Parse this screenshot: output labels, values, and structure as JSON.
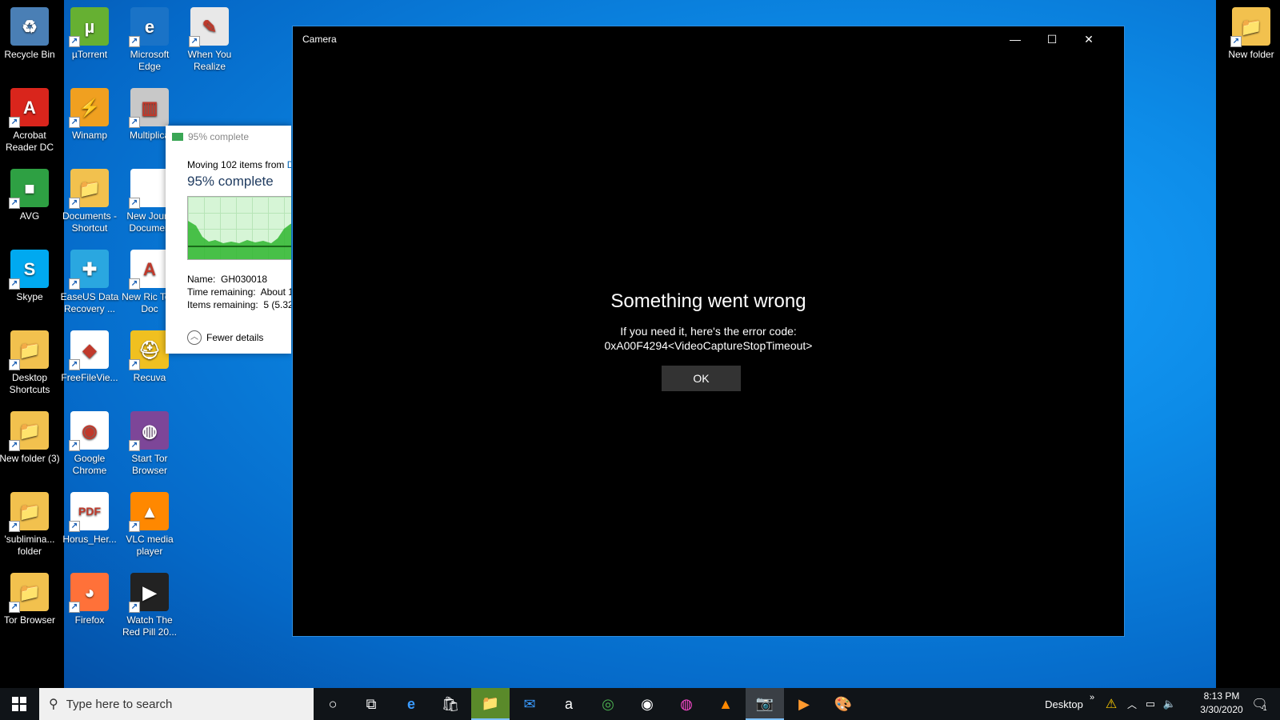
{
  "desktop": {
    "icons": [
      {
        "label": "Recycle Bin",
        "icon": "recycle-bin-icon",
        "color": "#4a7fb5",
        "glyph": "♻"
      },
      {
        "label": "µTorrent",
        "icon": "utorrent-icon",
        "color": "#66b032",
        "glyph": "µ"
      },
      {
        "label": "Microsoft Edge",
        "icon": "edge-icon",
        "color": "#1a73c7",
        "glyph": "e"
      },
      {
        "label": "When You Realize",
        "icon": "document-icon",
        "color": "#e8e8e8",
        "glyph": "✎"
      },
      {
        "label": "Acrobat Reader DC",
        "icon": "acrobat-icon",
        "color": "#d9251c",
        "glyph": "A"
      },
      {
        "label": "Winamp",
        "icon": "winamp-icon",
        "color": "#f0a020",
        "glyph": "⚡"
      },
      {
        "label": "Multiplica",
        "icon": "multiplica-icon",
        "color": "#c8c8c8",
        "glyph": "▥"
      },
      {
        "label": "AVG",
        "icon": "avg-icon",
        "color": "#2ea043",
        "glyph": "■"
      },
      {
        "label": "Documents - Shortcut",
        "icon": "folder-icon",
        "color": "#f2c14e",
        "glyph": "📁"
      },
      {
        "label": "New Journ Documen",
        "icon": "document-icon",
        "color": "#ffffff",
        "glyph": ""
      },
      {
        "label": "Skype",
        "icon": "skype-icon",
        "color": "#00a9f0",
        "glyph": "S"
      },
      {
        "label": "EaseUS Data Recovery ...",
        "icon": "easeus-icon",
        "color": "#2aa7e0",
        "glyph": "✚"
      },
      {
        "label": "New Ric Text Doc",
        "icon": "rich-text-icon",
        "color": "#ffffff",
        "glyph": "A"
      },
      {
        "label": "Desktop Shortcuts",
        "icon": "folder-icon",
        "color": "#f2c14e",
        "glyph": "📁"
      },
      {
        "label": "FreeFileVie...",
        "icon": "freefileviewer-icon",
        "color": "#ffffff",
        "glyph": "◆"
      },
      {
        "label": "Recuva",
        "icon": "recuva-icon",
        "color": "#f0c020",
        "glyph": "⛑"
      },
      {
        "label": "New folder (3)",
        "icon": "folder-icon",
        "color": "#f2c14e",
        "glyph": "📁"
      },
      {
        "label": "Google Chrome",
        "icon": "chrome-icon",
        "color": "#ffffff",
        "glyph": "◉"
      },
      {
        "label": "Start Tor Browser",
        "icon": "tor-icon",
        "color": "#7d4698",
        "glyph": "◍"
      },
      {
        "label": "'sublimina... folder",
        "icon": "folder-icon",
        "color": "#f2c14e",
        "glyph": "📁"
      },
      {
        "label": "Horus_Her...",
        "icon": "pdf-icon",
        "color": "#ffffff",
        "glyph": "PDF"
      },
      {
        "label": "VLC media player",
        "icon": "vlc-icon",
        "color": "#ff8800",
        "glyph": "▲"
      },
      {
        "label": "Tor Browser",
        "icon": "folder-icon",
        "color": "#f2c14e",
        "glyph": "📁"
      },
      {
        "label": "Firefox",
        "icon": "firefox-icon",
        "color": "#ff7139",
        "glyph": "◕"
      },
      {
        "label": "Watch The Red Pill 20...",
        "icon": "video-icon",
        "color": "#222222",
        "glyph": "▶"
      },
      {
        "label": "New folder",
        "icon": "folder-icon",
        "color": "#f2c14e",
        "glyph": "📁"
      }
    ]
  },
  "progress_dialog": {
    "title": "95% complete",
    "moving_text": "Moving 102 items from ",
    "moving_from": "D",
    "big_percent": "95% complete",
    "name_label": "Name:",
    "name_value": "GH030018",
    "time_label": "Time remaining:",
    "time_value": "About 1",
    "items_label": "Items remaining:",
    "items_value": "5 (5.32",
    "fewer_details": "Fewer details",
    "progress": 0.95
  },
  "camera_window": {
    "title": "Camera",
    "minimize": "—",
    "maximize": "☐",
    "close": "✕",
    "error_title": "Something went wrong",
    "error_line1": "If you need it, here's the error code:",
    "error_code": "0xA00F4294<VideoCaptureStopTimeout>",
    "ok_label": "OK"
  },
  "taskbar": {
    "start_icon": "windows-start-icon",
    "search_placeholder": "Type here to search",
    "desktop_label": "Desktop",
    "chevron": "»",
    "time": "8:13 PM",
    "date": "3/30/2020",
    "notification_count": "1"
  }
}
